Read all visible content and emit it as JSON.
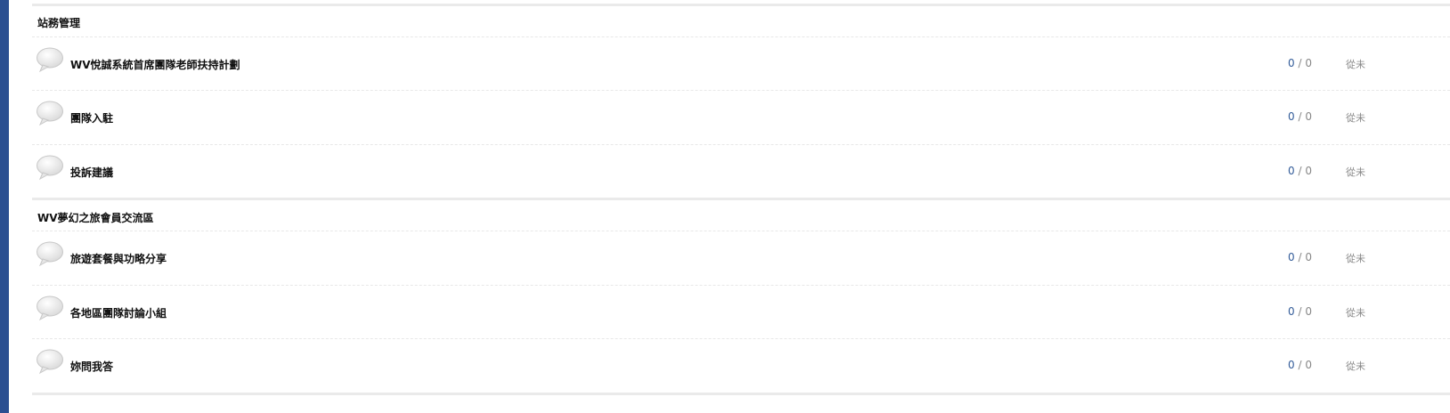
{
  "categories": [
    {
      "title": "站務管理",
      "forums": [
        {
          "name": "WV悅誠系統首席團隊老師扶持計劃",
          "topics": "0",
          "sep": "/",
          "posts": "0",
          "last_post": "從未"
        },
        {
          "name": "團隊入駐",
          "topics": "0",
          "sep": "/",
          "posts": "0",
          "last_post": "從未"
        },
        {
          "name": "投訴建議",
          "topics": "0",
          "sep": "/",
          "posts": "0",
          "last_post": "從未"
        }
      ]
    },
    {
      "title": "WV夢幻之旅會員交流區",
      "forums": [
        {
          "name": "旅遊套餐與功略分享",
          "topics": "0",
          "sep": "/",
          "posts": "0",
          "last_post": "從未"
        },
        {
          "name": "各地區團隊討論小組",
          "topics": "0",
          "sep": "/",
          "posts": "0",
          "last_post": "從未"
        },
        {
          "name": "妳問我答",
          "topics": "0",
          "sep": "/",
          "posts": "0",
          "last_post": "從未"
        }
      ]
    }
  ],
  "colors": {
    "sidebar": "#2b4f91",
    "topic_count": "#335c99",
    "muted": "#888888"
  },
  "icons": {
    "forum": "speech-bubble-icon"
  }
}
